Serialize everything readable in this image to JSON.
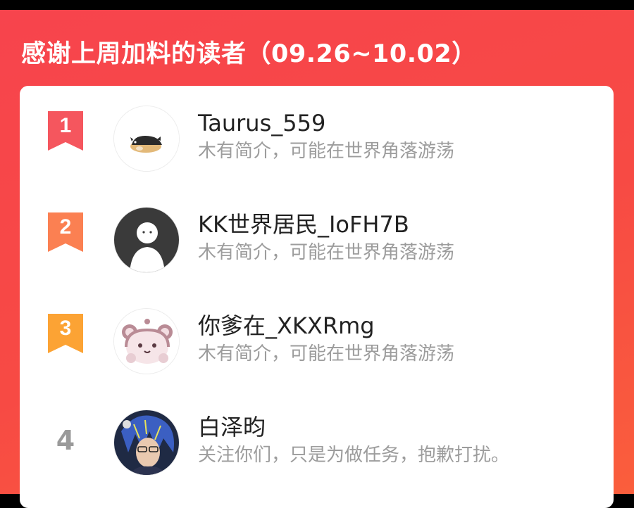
{
  "header": {
    "title": "感谢上周加料的读者（09.26~10.02）"
  },
  "colors": {
    "background_top": "#f7444d",
    "background_bottom": "#fa5e3c",
    "rank1": "#f5565e",
    "rank2": "#fb8052",
    "rank3": "#fca334",
    "rank_plain": "#9a9a9a"
  },
  "readers": [
    {
      "rank": "1",
      "name": "Taurus_559",
      "bio": "木有简介，可能在世界角落游荡",
      "avatar_icon": "hamster-avatar-icon"
    },
    {
      "rank": "2",
      "name": "KK世界居民_IoFH7B",
      "bio": "木有简介，可能在世界角落游荡",
      "avatar_icon": "default-person-avatar-icon"
    },
    {
      "rank": "3",
      "name": "你爹在_XKXRmg",
      "bio": "木有简介，可能在世界角落游荡",
      "avatar_icon": "bear-avatar-icon"
    },
    {
      "rank": "4",
      "name": "白泽昀",
      "bio": "关注你们，只是为做任务，抱歉打扰。",
      "avatar_icon": "anime-character-avatar-icon"
    }
  ]
}
